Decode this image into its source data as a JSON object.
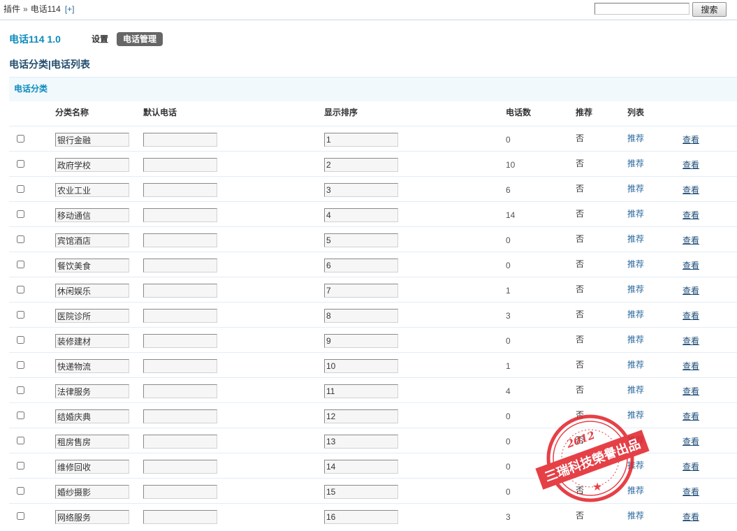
{
  "breadcrumb": {
    "root": "插件",
    "separator": "»",
    "current": "电话114",
    "add": "[+]"
  },
  "search": {
    "button_label": "搜索"
  },
  "plugin": {
    "title": "电话114 1.0",
    "tabs": [
      {
        "label": "设置",
        "active": false
      },
      {
        "label": "电话管理",
        "active": true
      }
    ]
  },
  "subnav": {
    "categories": "电话分类",
    "separator": "|",
    "list": "电话列表"
  },
  "section": {
    "title": "电话分类"
  },
  "table": {
    "headers": {
      "name": "分类名称",
      "default_phone": "默认电话",
      "order": "显示排序",
      "count": "电话数",
      "recommend": "推荐",
      "list": "列表"
    },
    "action_recommend": "推荐",
    "action_view": "查看",
    "rows": [
      {
        "selected": false,
        "name": "银行金融",
        "default_phone": "",
        "order": "1",
        "count": "0",
        "recommended": "否"
      },
      {
        "selected": false,
        "name": "政府学校",
        "default_phone": "",
        "order": "2",
        "count": "10",
        "recommended": "否"
      },
      {
        "selected": false,
        "name": "农业工业",
        "default_phone": "",
        "order": "3",
        "count": "6",
        "recommended": "否"
      },
      {
        "selected": false,
        "name": "移动通信",
        "default_phone": "",
        "order": "4",
        "count": "14",
        "recommended": "否"
      },
      {
        "selected": false,
        "name": "宾馆酒店",
        "default_phone": "",
        "order": "5",
        "count": "0",
        "recommended": "否"
      },
      {
        "selected": false,
        "name": "餐饮美食",
        "default_phone": "",
        "order": "6",
        "count": "0",
        "recommended": "否"
      },
      {
        "selected": false,
        "name": "休闲娱乐",
        "default_phone": "",
        "order": "7",
        "count": "1",
        "recommended": "否"
      },
      {
        "selected": false,
        "name": "医院诊所",
        "default_phone": "",
        "order": "8",
        "count": "3",
        "recommended": "否"
      },
      {
        "selected": false,
        "name": "装修建材",
        "default_phone": "",
        "order": "9",
        "count": "0",
        "recommended": "否"
      },
      {
        "selected": false,
        "name": "快递物流",
        "default_phone": "",
        "order": "10",
        "count": "1",
        "recommended": "否"
      },
      {
        "selected": false,
        "name": "法律服务",
        "default_phone": "",
        "order": "11",
        "count": "4",
        "recommended": "否"
      },
      {
        "selected": false,
        "name": "结婚庆典",
        "default_phone": "",
        "order": "12",
        "count": "0",
        "recommended": "否"
      },
      {
        "selected": false,
        "name": "租房售房",
        "default_phone": "",
        "order": "13",
        "count": "0",
        "recommended": "否"
      },
      {
        "selected": false,
        "name": "维修回收",
        "default_phone": "",
        "order": "14",
        "count": "0",
        "recommended": "否"
      },
      {
        "selected": false,
        "name": "婚纱摄影",
        "default_phone": "",
        "order": "15",
        "count": "0",
        "recommended": "否"
      },
      {
        "selected": false,
        "name": "网络服务",
        "default_phone": "",
        "order": "16",
        "count": "3",
        "recommended": "否"
      }
    ]
  },
  "stamp": {
    "year": "2012",
    "text": "三瑞科技榮譽出品"
  },
  "colors": {
    "accent": "#0C8BBD",
    "nav": "#234D6E",
    "link": "#2D6A9F",
    "tab_active_bg": "#666666",
    "section_bg": "#F2F9FD",
    "stamp": "#E3262E"
  },
  "icons": {
    "stamp": "red-seal-stamp"
  }
}
